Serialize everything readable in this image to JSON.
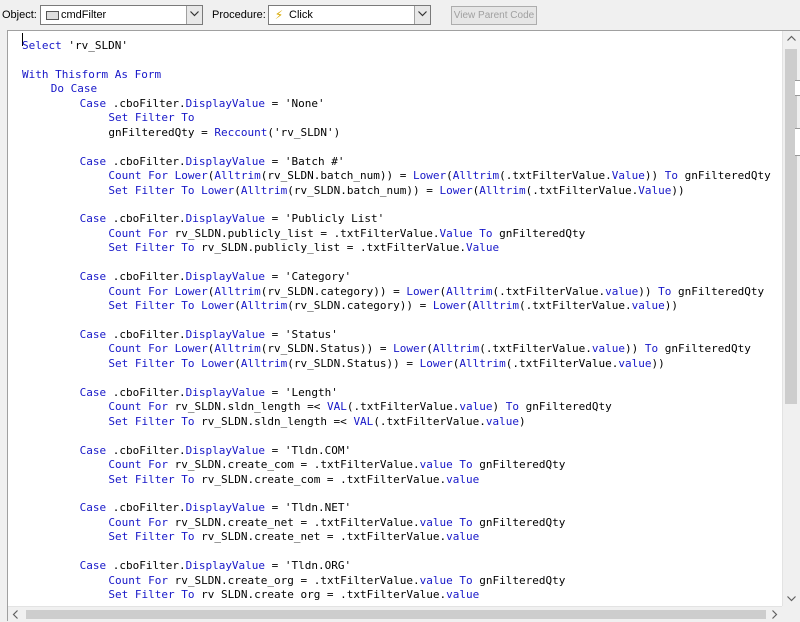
{
  "toolbar": {
    "object_label": "Object:",
    "object_value": "cmdFilter",
    "object_icon": "command-button-icon",
    "procedure_label": "Procedure:",
    "procedure_value": "Click",
    "procedure_icon": "lightning-bolt-icon",
    "view_parent_code": "View Parent Code"
  },
  "colors": {
    "keyword": "#1717c8",
    "text": "#000000",
    "background": "#ffffff"
  },
  "code_lines": [
    {
      "indent": 0,
      "parts": [
        {
          "t": "Select",
          "kw": true
        },
        {
          "t": " 'rv_SLDN'"
        }
      ]
    },
    {
      "indent": 0,
      "parts": [],
      "blank": true
    },
    {
      "indent": 0,
      "parts": [
        {
          "t": "With Thisform As Form",
          "kw": true
        }
      ]
    },
    {
      "indent": 1,
      "parts": [
        {
          "t": "Do Case",
          "kw": true
        }
      ]
    },
    {
      "indent": 2,
      "parts": [
        {
          "t": "Case",
          "kw": true
        },
        {
          "t": " .cboFilter."
        },
        {
          "t": "DisplayValue",
          "kw": true
        },
        {
          "t": " = 'None'"
        }
      ]
    },
    {
      "indent": 3,
      "parts": [
        {
          "t": "Set Filter To",
          "kw": true
        }
      ]
    },
    {
      "indent": 3,
      "parts": [
        {
          "t": "gnFilteredQty = "
        },
        {
          "t": "Reccount",
          "kw": true
        },
        {
          "t": "('rv_SLDN')"
        }
      ]
    },
    {
      "indent": 0,
      "parts": [],
      "blank": true
    },
    {
      "indent": 2,
      "parts": [
        {
          "t": "Case",
          "kw": true
        },
        {
          "t": " .cboFilter."
        },
        {
          "t": "DisplayValue",
          "kw": true
        },
        {
          "t": " = 'Batch #'"
        }
      ]
    },
    {
      "indent": 3,
      "parts": [
        {
          "t": "Count For Lower",
          "kw": true
        },
        {
          "t": "("
        },
        {
          "t": "Alltrim",
          "kw": true
        },
        {
          "t": "(rv_SLDN.batch_num)) = "
        },
        {
          "t": "Lower",
          "kw": true
        },
        {
          "t": "("
        },
        {
          "t": "Alltrim",
          "kw": true
        },
        {
          "t": "(.txtFilterValue."
        },
        {
          "t": "Value",
          "kw": true
        },
        {
          "t": ")) "
        },
        {
          "t": "To",
          "kw": true
        },
        {
          "t": " gnFilteredQty"
        }
      ]
    },
    {
      "indent": 3,
      "parts": [
        {
          "t": "Set Filter To Lower",
          "kw": true
        },
        {
          "t": "("
        },
        {
          "t": "Alltrim",
          "kw": true
        },
        {
          "t": "(rv_SLDN.batch_num)) = "
        },
        {
          "t": "Lower",
          "kw": true
        },
        {
          "t": "("
        },
        {
          "t": "Alltrim",
          "kw": true
        },
        {
          "t": "(.txtFilterValue."
        },
        {
          "t": "Value",
          "kw": true
        },
        {
          "t": "))"
        }
      ]
    },
    {
      "indent": 0,
      "parts": [],
      "blank": true
    },
    {
      "indent": 2,
      "parts": [
        {
          "t": "Case",
          "kw": true
        },
        {
          "t": " .cboFilter."
        },
        {
          "t": "DisplayValue",
          "kw": true
        },
        {
          "t": " = 'Publicly List'"
        }
      ]
    },
    {
      "indent": 3,
      "parts": [
        {
          "t": "Count For",
          "kw": true
        },
        {
          "t": " rv_SLDN.publicly_list = .txtFilterValue."
        },
        {
          "t": "Value To",
          "kw": true
        },
        {
          "t": " gnFilteredQty"
        }
      ]
    },
    {
      "indent": 3,
      "parts": [
        {
          "t": "Set Filter To",
          "kw": true
        },
        {
          "t": " rv_SLDN.publicly_list = .txtFilterValue."
        },
        {
          "t": "Value",
          "kw": true
        }
      ]
    },
    {
      "indent": 0,
      "parts": [],
      "blank": true
    },
    {
      "indent": 2,
      "parts": [
        {
          "t": "Case",
          "kw": true
        },
        {
          "t": " .cboFilter."
        },
        {
          "t": "DisplayValue",
          "kw": true
        },
        {
          "t": " = 'Category'"
        }
      ]
    },
    {
      "indent": 3,
      "parts": [
        {
          "t": "Count For Lower",
          "kw": true
        },
        {
          "t": "("
        },
        {
          "t": "Alltrim",
          "kw": true
        },
        {
          "t": "(rv_SLDN.category)) = "
        },
        {
          "t": "Lower",
          "kw": true
        },
        {
          "t": "("
        },
        {
          "t": "Alltrim",
          "kw": true
        },
        {
          "t": "(.txtFilterValue."
        },
        {
          "t": "value",
          "kw": true
        },
        {
          "t": ")) "
        },
        {
          "t": "To",
          "kw": true
        },
        {
          "t": " gnFilteredQty"
        }
      ]
    },
    {
      "indent": 3,
      "parts": [
        {
          "t": "Set Filter To Lower",
          "kw": true
        },
        {
          "t": "("
        },
        {
          "t": "Alltrim",
          "kw": true
        },
        {
          "t": "(rv_SLDN.category)) = "
        },
        {
          "t": "Lower",
          "kw": true
        },
        {
          "t": "("
        },
        {
          "t": "Alltrim",
          "kw": true
        },
        {
          "t": "(.txtFilterValue."
        },
        {
          "t": "value",
          "kw": true
        },
        {
          "t": "))"
        }
      ]
    },
    {
      "indent": 0,
      "parts": [],
      "blank": true
    },
    {
      "indent": 2,
      "parts": [
        {
          "t": "Case",
          "kw": true
        },
        {
          "t": " .cboFilter."
        },
        {
          "t": "DisplayValue",
          "kw": true
        },
        {
          "t": " = 'Status'"
        }
      ]
    },
    {
      "indent": 3,
      "parts": [
        {
          "t": "Count For Lower",
          "kw": true
        },
        {
          "t": "("
        },
        {
          "t": "Alltrim",
          "kw": true
        },
        {
          "t": "(rv_SLDN.Status)) = "
        },
        {
          "t": "Lower",
          "kw": true
        },
        {
          "t": "("
        },
        {
          "t": "Alltrim",
          "kw": true
        },
        {
          "t": "(.txtFilterValue."
        },
        {
          "t": "value",
          "kw": true
        },
        {
          "t": ")) "
        },
        {
          "t": "To",
          "kw": true
        },
        {
          "t": " gnFilteredQty"
        }
      ]
    },
    {
      "indent": 3,
      "parts": [
        {
          "t": "Set Filter To Lower",
          "kw": true
        },
        {
          "t": "("
        },
        {
          "t": "Alltrim",
          "kw": true
        },
        {
          "t": "(rv_SLDN.Status)) = "
        },
        {
          "t": "Lower",
          "kw": true
        },
        {
          "t": "("
        },
        {
          "t": "Alltrim",
          "kw": true
        },
        {
          "t": "(.txtFilterValue."
        },
        {
          "t": "value",
          "kw": true
        },
        {
          "t": "))"
        }
      ]
    },
    {
      "indent": 0,
      "parts": [],
      "blank": true
    },
    {
      "indent": 2,
      "parts": [
        {
          "t": "Case",
          "kw": true
        },
        {
          "t": " .cboFilter."
        },
        {
          "t": "DisplayValue",
          "kw": true
        },
        {
          "t": " = 'Length'"
        }
      ]
    },
    {
      "indent": 3,
      "parts": [
        {
          "t": "Count For",
          "kw": true
        },
        {
          "t": " rv_SLDN.sldn_length =< "
        },
        {
          "t": "VAL",
          "kw": true
        },
        {
          "t": "(.txtFilterValue."
        },
        {
          "t": "value",
          "kw": true
        },
        {
          "t": ") "
        },
        {
          "t": "To",
          "kw": true
        },
        {
          "t": " gnFilteredQty"
        }
      ]
    },
    {
      "indent": 3,
      "parts": [
        {
          "t": "Set Filter To",
          "kw": true
        },
        {
          "t": " rv_SLDN.sldn_length =< "
        },
        {
          "t": "VAL",
          "kw": true
        },
        {
          "t": "(.txtFilterValue."
        },
        {
          "t": "value",
          "kw": true
        },
        {
          "t": ")"
        }
      ]
    },
    {
      "indent": 0,
      "parts": [],
      "blank": true
    },
    {
      "indent": 2,
      "parts": [
        {
          "t": "Case",
          "kw": true
        },
        {
          "t": " .cboFilter."
        },
        {
          "t": "DisplayValue",
          "kw": true
        },
        {
          "t": " = 'Tldn.COM'"
        }
      ]
    },
    {
      "indent": 3,
      "parts": [
        {
          "t": "Count For",
          "kw": true
        },
        {
          "t": " rv_SLDN.create_com = .txtFilterValue."
        },
        {
          "t": "value To",
          "kw": true
        },
        {
          "t": " gnFilteredQty"
        }
      ]
    },
    {
      "indent": 3,
      "parts": [
        {
          "t": "Set Filter To",
          "kw": true
        },
        {
          "t": " rv_SLDN.create_com = .txtFilterValue."
        },
        {
          "t": "value",
          "kw": true
        }
      ]
    },
    {
      "indent": 0,
      "parts": [],
      "blank": true
    },
    {
      "indent": 2,
      "parts": [
        {
          "t": "Case",
          "kw": true
        },
        {
          "t": " .cboFilter."
        },
        {
          "t": "DisplayValue",
          "kw": true
        },
        {
          "t": " = 'Tldn.NET'"
        }
      ]
    },
    {
      "indent": 3,
      "parts": [
        {
          "t": "Count For",
          "kw": true
        },
        {
          "t": " rv_SLDN.create_net = .txtFilterValue."
        },
        {
          "t": "value To",
          "kw": true
        },
        {
          "t": " gnFilteredQty"
        }
      ]
    },
    {
      "indent": 3,
      "parts": [
        {
          "t": "Set Filter To",
          "kw": true
        },
        {
          "t": " rv_SLDN.create_net = .txtFilterValue."
        },
        {
          "t": "value",
          "kw": true
        }
      ]
    },
    {
      "indent": 0,
      "parts": [],
      "blank": true
    },
    {
      "indent": 2,
      "parts": [
        {
          "t": "Case",
          "kw": true
        },
        {
          "t": " .cboFilter."
        },
        {
          "t": "DisplayValue",
          "kw": true
        },
        {
          "t": " = 'Tldn.ORG'"
        }
      ]
    },
    {
      "indent": 3,
      "parts": [
        {
          "t": "Count For",
          "kw": true
        },
        {
          "t": " rv_SLDN.create_org = .txtFilterValue."
        },
        {
          "t": "value To",
          "kw": true
        },
        {
          "t": " gnFilteredQty"
        }
      ]
    },
    {
      "indent": 3,
      "parts": [
        {
          "t": "Set Filter To",
          "kw": true
        },
        {
          "t": " rv SLDN.create org = .txtFilterValue."
        },
        {
          "t": "value",
          "kw": true
        }
      ]
    }
  ]
}
